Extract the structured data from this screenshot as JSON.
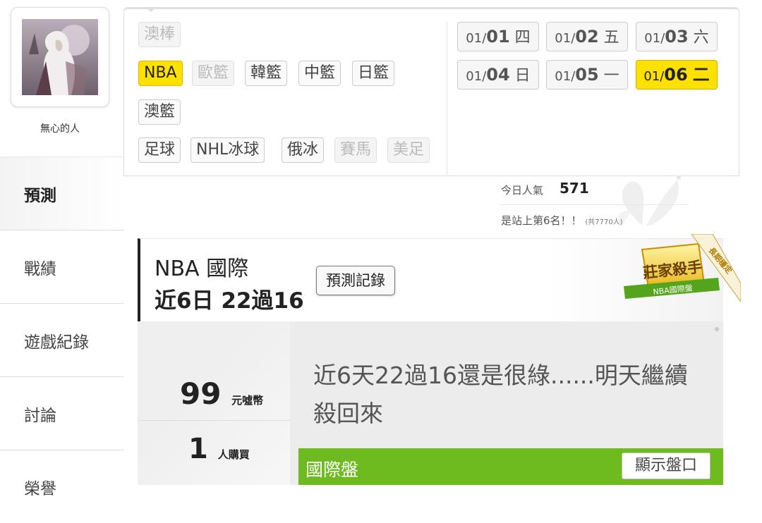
{
  "user": {
    "name": "無心的人"
  },
  "nav": {
    "items": [
      {
        "label": "預測",
        "active": true
      },
      {
        "label": "戰績"
      },
      {
        "label": "遊戲紀錄"
      },
      {
        "label": "討論"
      },
      {
        "label": "榮譽"
      }
    ]
  },
  "sports": {
    "rows": [
      [
        {
          "label": "澳棒",
          "state": "disabled"
        }
      ],
      [
        {
          "label": "NBA",
          "state": "active"
        },
        {
          "label": "歐籃",
          "state": "disabled"
        },
        {
          "label": "韓籃",
          "state": "normal"
        },
        {
          "label": "中籃",
          "state": "normal"
        },
        {
          "label": "日籃",
          "state": "normal"
        }
      ],
      [
        {
          "label": "澳籃",
          "state": "normal"
        }
      ],
      [
        {
          "label": "足球",
          "state": "normal"
        },
        {
          "label": "NHL冰球",
          "state": "normal"
        },
        {
          "label": "俄冰",
          "state": "normal"
        },
        {
          "label": "賽馬",
          "state": "disabled"
        },
        {
          "label": "美足",
          "state": "disabled"
        }
      ]
    ]
  },
  "dates": [
    {
      "month": "01/",
      "day": "01",
      "weekday": "四",
      "active": false
    },
    {
      "month": "01/",
      "day": "02",
      "weekday": "五",
      "active": false
    },
    {
      "month": "01/",
      "day": "03",
      "weekday": "六",
      "active": false
    },
    {
      "month": "01/",
      "day": "04",
      "weekday": "日",
      "active": false
    },
    {
      "month": "01/",
      "day": "05",
      "weekday": "一",
      "active": false
    },
    {
      "month": "01/",
      "day": "06",
      "weekday": "二",
      "active": true
    }
  ],
  "popularity": {
    "label": "今日人氣",
    "value": "571",
    "rank_text": "是站上第6名！！",
    "rank_total": "(共7770人)"
  },
  "card": {
    "league": "NBA 國際",
    "record": "近6日 22過16",
    "record_button": "預測記錄",
    "badge": {
      "ribbon": "長期穩定",
      "title": "莊家殺手",
      "subtitle": "NBA國際盤"
    },
    "price": "99",
    "price_unit": "元噓幣",
    "buyers": "1",
    "buyers_unit": "人購買",
    "comment": "近6天22過16還是很綠......明天繼續殺回來",
    "section_title": "國際盤",
    "show_button": "顯示盤口"
  },
  "colors": {
    "highlight": "#ffe100",
    "green": "#6ebb1f"
  }
}
